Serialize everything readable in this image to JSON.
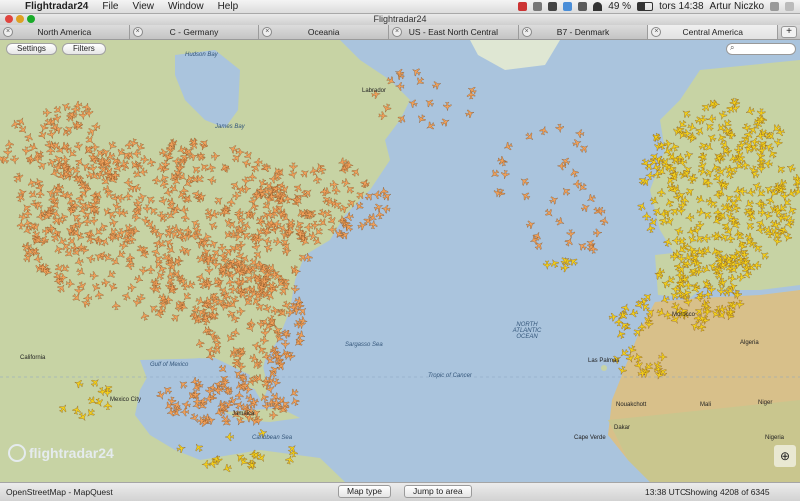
{
  "menubar": {
    "app_name": "Flightradar24",
    "items": [
      "File",
      "View",
      "Window",
      "Help"
    ],
    "battery": "49 %",
    "clock": "tors 14:38",
    "user": "Artur Niczko"
  },
  "window": {
    "title": "Flightradar24"
  },
  "tabs": [
    {
      "label": "North America",
      "active": false
    },
    {
      "label": "C - Germany",
      "active": false
    },
    {
      "label": "Oceania",
      "active": false
    },
    {
      "label": "US - East North Central",
      "active": false
    },
    {
      "label": "B7 - Denmark",
      "active": false
    },
    {
      "label": "Central America",
      "active": true
    }
  ],
  "new_tab_label": "+",
  "map_controls": {
    "settings_label": "Settings",
    "filters_label": "Filters"
  },
  "labels": {
    "hudson_bay": "Hudson Bay",
    "james_bay": "James Bay",
    "labrador": "Labrador",
    "north_atlantic": "NORTH ATLANTIC OCEAN",
    "sargasso": "Sargasso Sea",
    "tropic": "Tropic of Cancer",
    "gulf": "Gulf of Mexico",
    "mexico_city": "Mexico City",
    "jamaica": "Jamaica",
    "caribbean": "Caribbean Sea",
    "california": "California",
    "morocco": "Morocco",
    "algeria": "Algeria",
    "mali": "Mali",
    "niger": "Niger",
    "nigeria": "Nigeria",
    "dakar": "Dakar",
    "nouakchott": "Nouakchott",
    "cape_verde": "Cape Verde",
    "las_palmas": "Las Palmas"
  },
  "logo_text": "flightradar24",
  "statusbar": {
    "attribution": "OpenStreetMap - MapQuest",
    "map_type_label": "Map type",
    "jump_label": "Jump to area",
    "utc_time": "13:38 UTC",
    "showing": "Showing 4208 of 6345"
  },
  "colors": {
    "ocean": "#aac4dd",
    "land": "#c7d3a4",
    "desert": "#d8c08a",
    "plane_orange": "#f0a05a",
    "plane_yellow": "#f2d01a"
  },
  "icons": {
    "apple": "apple-icon",
    "search": "search-icon",
    "close_tab": "close-tab-icon",
    "plane": "airplane-icon"
  }
}
